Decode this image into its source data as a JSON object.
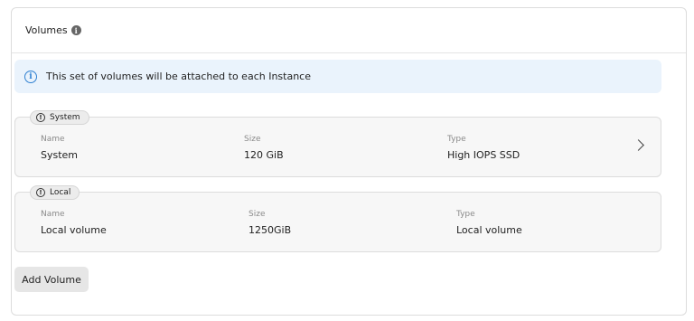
{
  "header": {
    "title": "Volumes",
    "info_icon": "info-filled-icon"
  },
  "banner": {
    "icon": "info-outline-icon",
    "text": "This set of volumes will be attached to each Instance"
  },
  "volumes": [
    {
      "tag": "System",
      "tag_icon": "alert-circle-icon",
      "name_label": "Name",
      "name_value": "System",
      "size_label": "Size",
      "size_value": "120 GiB",
      "type_label": "Type",
      "type_value": "High IOPS SSD",
      "has_chevron": true
    },
    {
      "tag": "Local",
      "tag_icon": "alert-circle-icon",
      "name_label": "Name",
      "name_value": "Local volume",
      "size_label": "Size",
      "size_value": "1250GiB",
      "type_label": "Type",
      "type_value": "Local volume",
      "has_chevron": false
    }
  ],
  "actions": {
    "add_volume_label": "Add Volume"
  },
  "colors": {
    "banner_bg": "#eaf3fc",
    "banner_icon": "#2f80d1",
    "volume_bg": "#f7f7f7",
    "button_bg": "#e6e6e6"
  }
}
